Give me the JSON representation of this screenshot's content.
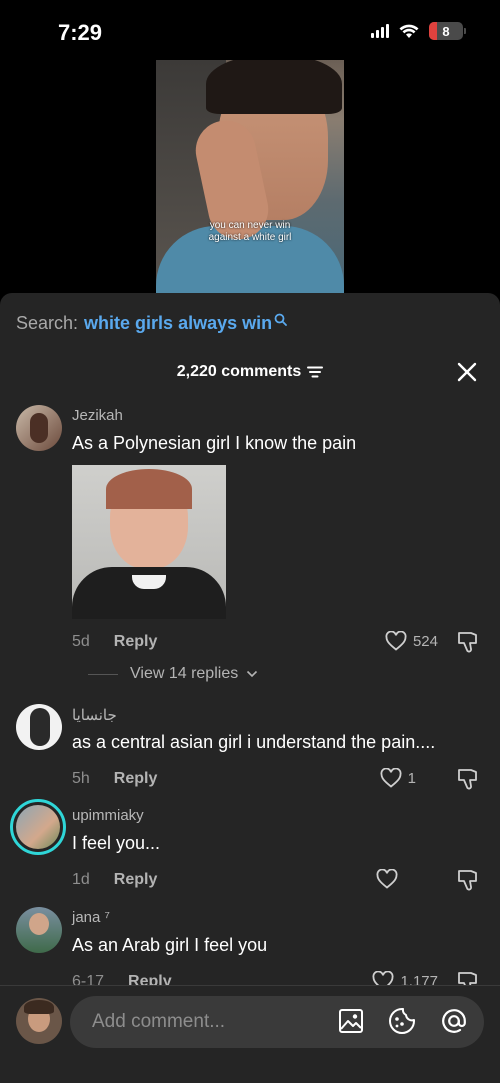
{
  "status_bar": {
    "time": "7:29",
    "battery": "8",
    "battery_level": 0.08
  },
  "video": {
    "caption_line1": "you can never win",
    "caption_line2": "against a white girl"
  },
  "search": {
    "prefix": "Search:",
    "query": "white girls always win"
  },
  "comments_header": {
    "count_label": "2,220 comments"
  },
  "comments": [
    {
      "username": "Jezikah",
      "text": "As a Polynesian girl I know the pain",
      "age": "5d",
      "reply_label": "Reply",
      "likes": "524",
      "view_replies": "View 14 replies"
    },
    {
      "username": "جانسايا",
      "text": "as a central asian girl i understand the pain....",
      "age": "5h",
      "reply_label": "Reply",
      "likes": "1"
    },
    {
      "username": "upimmiaky",
      "text": "I feel you...",
      "age": "1d",
      "reply_label": "Reply",
      "likes": ""
    },
    {
      "username": "jana ⁷",
      "text": "As an Arab girl I feel you",
      "age": "6-17",
      "reply_label": "Reply",
      "likes": "1,177"
    }
  ],
  "composer": {
    "placeholder": "Add comment..."
  },
  "colors": {
    "accent_link": "#5aa9ee",
    "sheet_bg": "#252525",
    "battery_red": "#e0423e",
    "story_ring": "#2fd6d8"
  },
  "icons": [
    "search-icon",
    "filter-icon",
    "close-icon",
    "heart-icon",
    "dislike-icon",
    "chevron-down-icon",
    "image-icon",
    "emoji-icon",
    "at-icon",
    "wifi-icon",
    "signal-icon"
  ]
}
